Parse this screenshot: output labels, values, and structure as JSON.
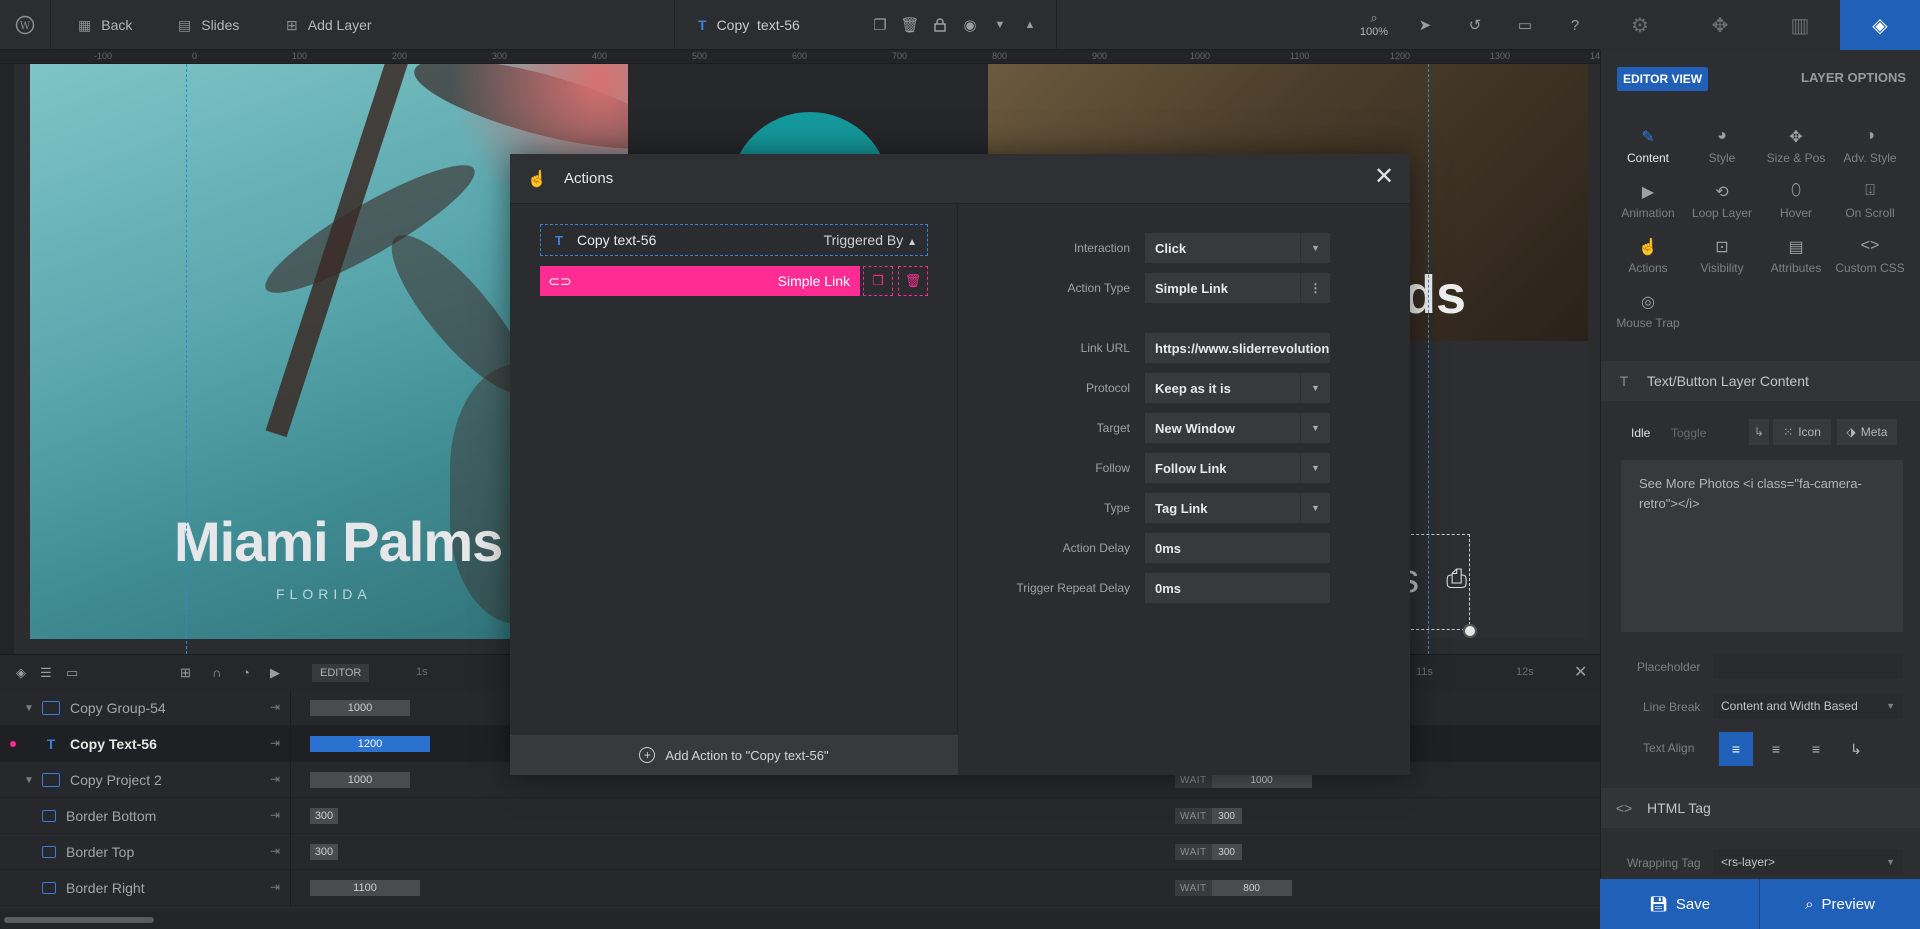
{
  "topbar": {
    "back_label": "Back",
    "slides_label": "Slides",
    "add_layer_label": "Add Layer",
    "layer_name": "Copy  text-56",
    "zoom": "100%"
  },
  "ruler": {
    "ticks": [
      "-100",
      "0",
      "100",
      "200",
      "300",
      "400",
      "500",
      "600",
      "700",
      "800",
      "900",
      "1000",
      "1100",
      "1200",
      "1300",
      "14"
    ]
  },
  "canvas": {
    "miami_title": "Miami Palms",
    "florida": "FLORIDA",
    "right_title": "nds",
    "button_text": "s"
  },
  "timeline": {
    "editor_label": "EDITOR",
    "time_marks": [
      "1s",
      "11s",
      "12s"
    ],
    "rows": [
      {
        "name": "Copy Group-54",
        "bar": "1000",
        "wait": ""
      },
      {
        "name": "Copy Text-56",
        "bar": "1200",
        "wait": ""
      },
      {
        "name": "Copy Project 2",
        "bar": "1000",
        "wait": "1000"
      },
      {
        "name": "Border Bottom",
        "bar": "300",
        "wait": "300"
      },
      {
        "name": "Border Top",
        "bar": "300",
        "wait": "300"
      },
      {
        "name": "Border Right",
        "bar": "1100",
        "wait": "800"
      }
    ],
    "wait_label": "WAIT"
  },
  "right_panel": {
    "editor_view": "EDITOR VIEW",
    "layer_options": "LAYER OPTIONS",
    "options": [
      {
        "label": "Content",
        "icon": "pencil-icon"
      },
      {
        "label": "Style",
        "icon": "palette-icon"
      },
      {
        "label": "Size & Pos",
        "icon": "move-icon"
      },
      {
        "label": "Adv. Style",
        "icon": "contrast-icon"
      },
      {
        "label": "Animation",
        "icon": "play-icon"
      },
      {
        "label": "Loop Layer",
        "icon": "loop-icon"
      },
      {
        "label": "Hover",
        "icon": "mouse-icon"
      },
      {
        "label": "On Scroll",
        "icon": "scroll-icon"
      },
      {
        "label": "Actions",
        "icon": "hand-icon"
      },
      {
        "label": "Visibility",
        "icon": "visibility-icon"
      },
      {
        "label": "Attributes",
        "icon": "file-icon"
      },
      {
        "label": "Custom CSS",
        "icon": "code-icon"
      },
      {
        "label": "Mouse Trap",
        "icon": "target-icon"
      }
    ],
    "content_section": "Text/Button Layer Content",
    "idle": "Idle",
    "toggle": "Toggle",
    "icon_btn": "Icon",
    "meta_btn": "Meta",
    "content_text": "See More Photos <i class=\"fa-camera-retro\"></i>",
    "placeholder_label": "Placeholder",
    "line_break_label": "Line Break",
    "line_break_value": "Content and Width Based",
    "text_align_label": "Text Align",
    "html_tag_section": "HTML Tag",
    "wrapping_tag_label": "Wrapping Tag",
    "wrapping_tag_value": "<rs-layer>",
    "save": "Save",
    "preview": "Preview"
  },
  "modal": {
    "title": "Actions",
    "trigger_layer": "Copy text-56",
    "triggered_by": "Triggered By",
    "action_item": "Simple Link",
    "add_action": "Add Action to \"Copy text-56\"",
    "fields": {
      "interaction": {
        "label": "Interaction",
        "value": "Click"
      },
      "action_type": {
        "label": "Action Type",
        "value": "Simple Link"
      },
      "link_url": {
        "label": "Link URL",
        "value": "https://www.sliderrevolution.com"
      },
      "protocol": {
        "label": "Protocol",
        "value": "Keep as it is"
      },
      "target": {
        "label": "Target",
        "value": "New Window"
      },
      "follow": {
        "label": "Follow",
        "value": "Follow Link"
      },
      "type": {
        "label": "Type",
        "value": "Tag Link"
      },
      "action_delay": {
        "label": "Action Delay",
        "value": "0ms"
      },
      "trigger_repeat_delay": {
        "label": "Trigger Repeat Delay",
        "value": "0ms"
      }
    }
  },
  "colors": {
    "accent_blue": "#2060b8",
    "action_pink": "#ff2d93",
    "teal": "#14999c"
  }
}
